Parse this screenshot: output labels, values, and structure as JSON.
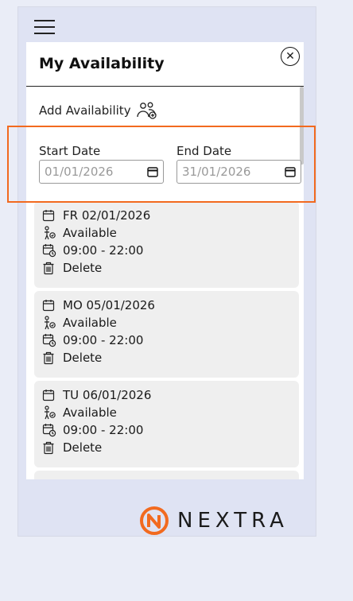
{
  "panel": {
    "title": "My Availability"
  },
  "add_availability": {
    "label": "Add Availability"
  },
  "start_date": {
    "label": "Start Date",
    "value": "01/01/2026"
  },
  "end_date": {
    "label": "End Date",
    "value": "31/01/2026"
  },
  "entries": [
    {
      "date": "FR 02/01/2026",
      "status": "Available",
      "time": "09:00 - 22:00",
      "delete": "Delete"
    },
    {
      "date": "MO 05/01/2026",
      "status": "Available",
      "time": "09:00 - 22:00",
      "delete": "Delete"
    },
    {
      "date": "TU 06/01/2026",
      "status": "Available",
      "time": "09:00 - 22:00",
      "delete": "Delete"
    }
  ],
  "brand": {
    "name": "NEXTRA",
    "accent": "#f26a1f"
  },
  "colors": {
    "highlight": "#f26a1f",
    "card_bg": "#efefef",
    "frame_bg": "#dfe3f3"
  }
}
